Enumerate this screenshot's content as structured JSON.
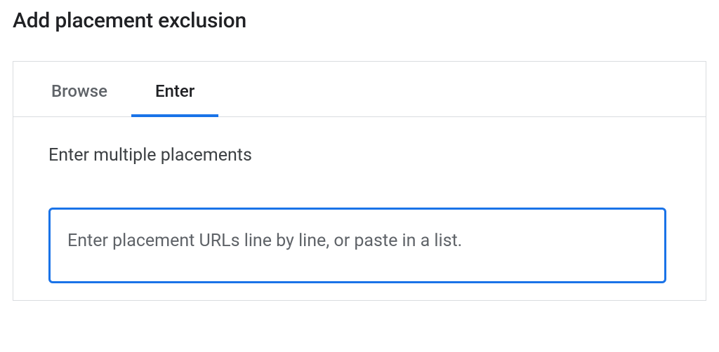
{
  "header": {
    "title": "Add placement exclusion"
  },
  "tabs": {
    "browse": {
      "label": "Browse"
    },
    "enter": {
      "label": "Enter"
    }
  },
  "content": {
    "section_label": "Enter multiple placements",
    "textarea_placeholder": "Enter placement URLs line by line, or paste in a list.",
    "textarea_value": ""
  }
}
